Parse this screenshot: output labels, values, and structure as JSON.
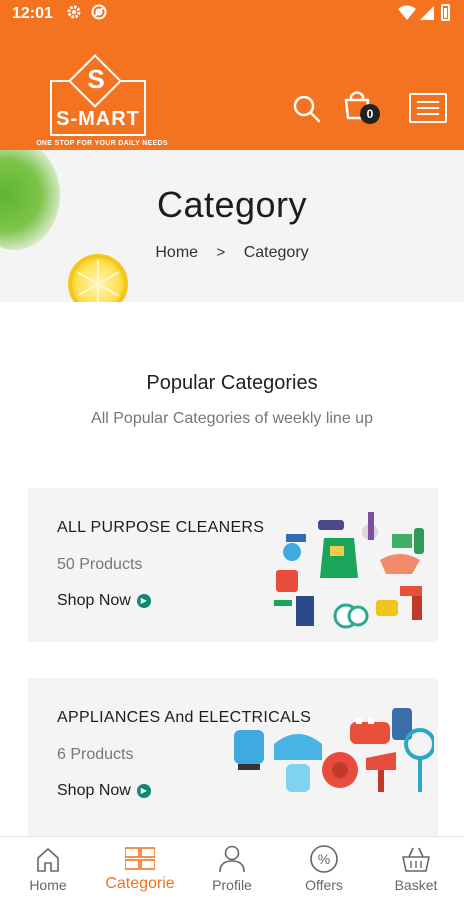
{
  "status_bar": {
    "time": "12:01"
  },
  "header": {
    "logo_text": "S-MART",
    "logo_letter": "S",
    "tagline": "ONE STOP FOR YOUR DAILY NEEDS",
    "cart_count": "0",
    "brand_color": "#f47321"
  },
  "banner": {
    "title": "Category",
    "breadcrumb": {
      "home": "Home",
      "separator": ">",
      "current": "Category"
    }
  },
  "popular": {
    "title": "Popular Categories",
    "subtitle": "All Popular Categories of weekly line up"
  },
  "categories": [
    {
      "title": "ALL PURPOSE CLEANERS",
      "count": "50 Products",
      "shop_label": "Shop Now"
    },
    {
      "title": "APPLIANCES And ELECTRICALS",
      "count": "6 Products",
      "shop_label": "Shop Now"
    }
  ],
  "bottom_nav": {
    "items": [
      {
        "label": "Home",
        "icon": "home-icon"
      },
      {
        "label": "Categorie",
        "icon": "grid-icon",
        "active": true
      },
      {
        "label": "Profile",
        "icon": "person-icon"
      },
      {
        "label": "Offers",
        "icon": "percent-icon"
      },
      {
        "label": "Basket",
        "icon": "basket-icon"
      }
    ],
    "active_color": "#f47321"
  }
}
